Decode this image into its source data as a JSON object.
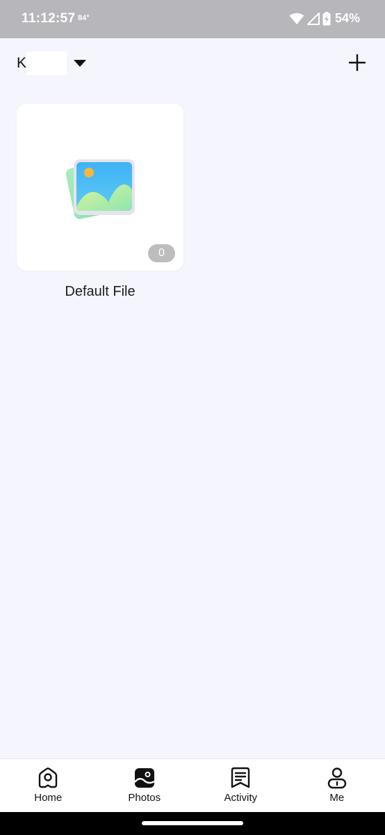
{
  "status_bar": {
    "time": "11:12:57",
    "temperature": "84°",
    "battery": "54%"
  },
  "header": {
    "account_initial": "K"
  },
  "albums": [
    {
      "name": "Default File",
      "count": "0"
    }
  ],
  "nav": {
    "home": "Home",
    "photos": "Photos",
    "activity": "Activity",
    "me": "Me",
    "active": "photos"
  },
  "icons": {
    "wifi": "wifi-icon",
    "signal": "signal-icon",
    "battery": "battery-charging-icon",
    "dropdown": "caret-down-icon",
    "add": "plus-icon",
    "album_thumb": "photo-stack-icon",
    "home": "home-icon",
    "photos": "photos-icon",
    "activity": "activity-icon",
    "me": "person-icon"
  },
  "colors": {
    "background": "#f4f5fd",
    "status_bar": "#b7b7bb",
    "card": "#ffffff",
    "badge": "#bdbdbd",
    "nav_background": "#ffffff"
  }
}
